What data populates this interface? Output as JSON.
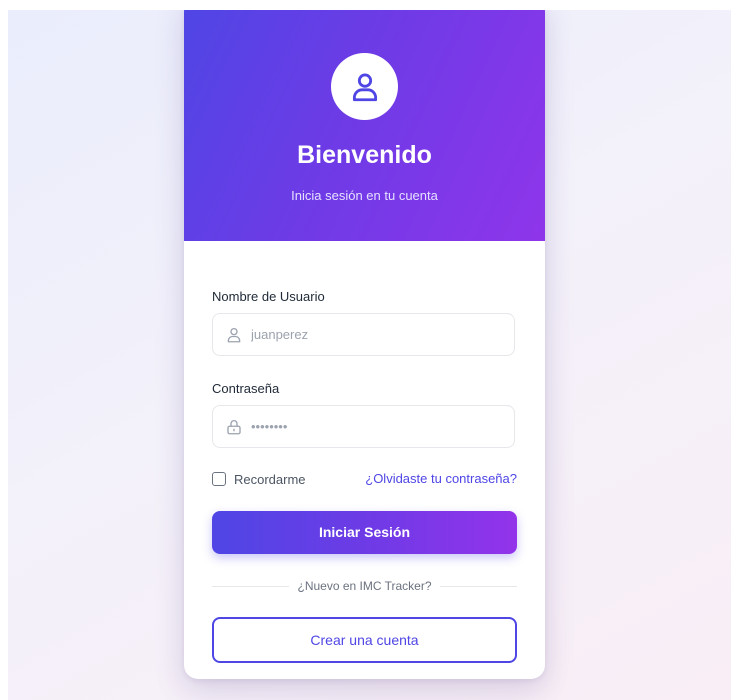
{
  "header": {
    "title": "Bienvenido",
    "subtitle": "Inicia sesión en tu cuenta",
    "avatar_icon": "user-icon"
  },
  "form": {
    "username": {
      "label": "Nombre de Usuario",
      "placeholder": "juanperez",
      "value": "",
      "icon": "user-icon"
    },
    "password": {
      "label": "Contraseña",
      "placeholder": "••••••••",
      "value": "",
      "icon": "lock-icon"
    },
    "remember_label": "Recordarme",
    "remember_checked": false,
    "forgot_link": "¿Olvidaste tu contraseña?",
    "submit_label": "Iniciar Sesión",
    "divider_text": "¿Nuevo en IMC Tracker?",
    "register_label": "Crear una cuenta"
  },
  "colors": {
    "accent": "#4f46e5",
    "accent_end": "#9333ea",
    "text": "#1f2937",
    "muted": "#6b7280"
  }
}
